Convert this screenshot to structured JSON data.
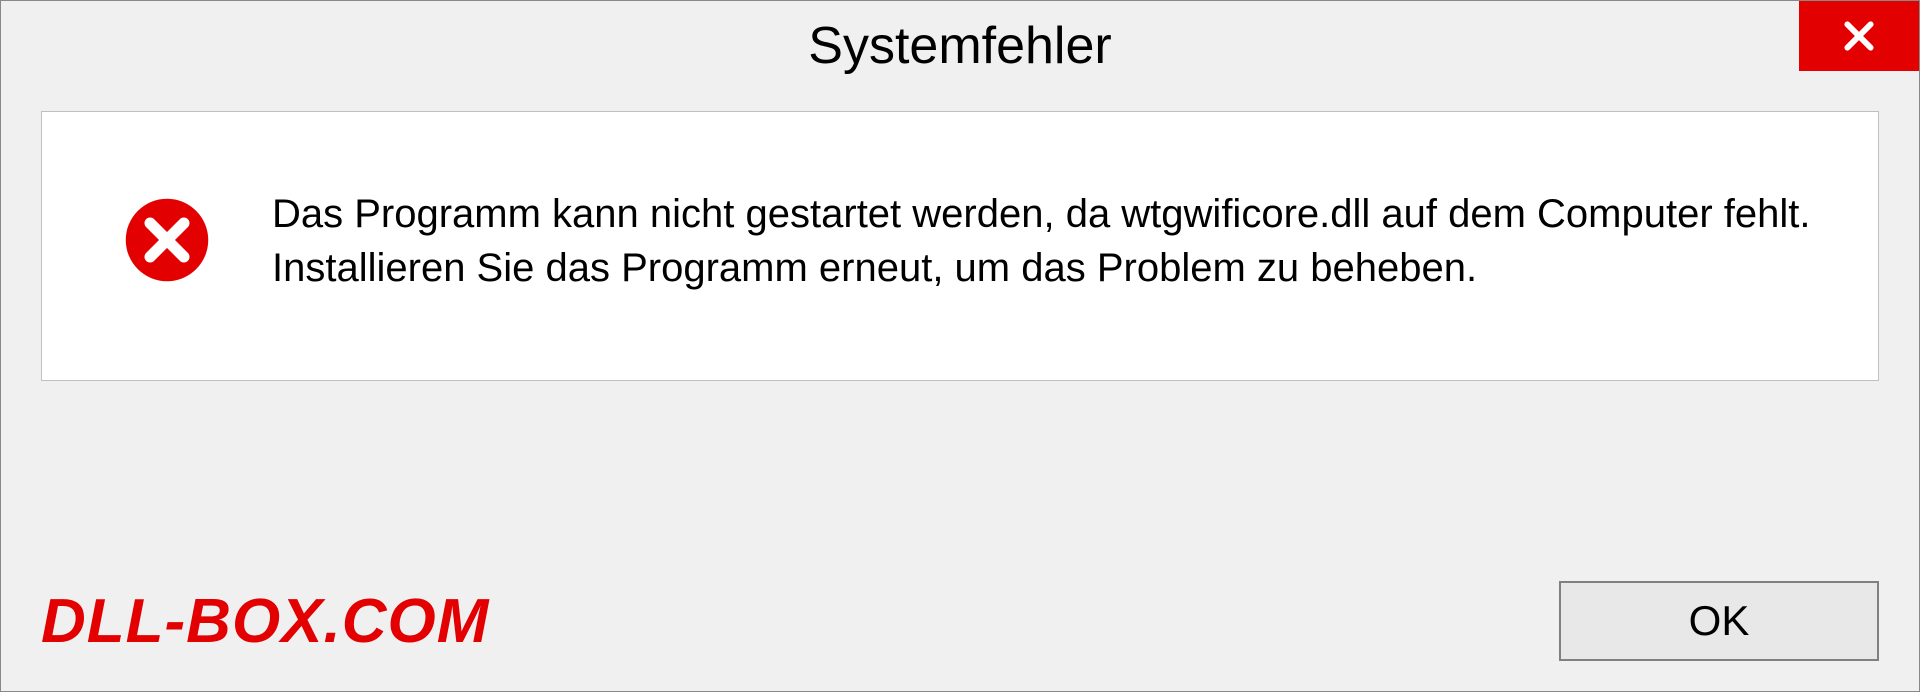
{
  "dialog": {
    "title": "Systemfehler",
    "message": "Das Programm kann nicht gestartet werden, da wtgwificore.dll auf dem Computer fehlt. Installieren Sie das Programm erneut, um das Problem zu beheben.",
    "ok_label": "OK"
  },
  "watermark": "DLL-BOX.COM",
  "colors": {
    "accent_red": "#e20000",
    "bg": "#f0f0f0",
    "content_bg": "#ffffff"
  }
}
